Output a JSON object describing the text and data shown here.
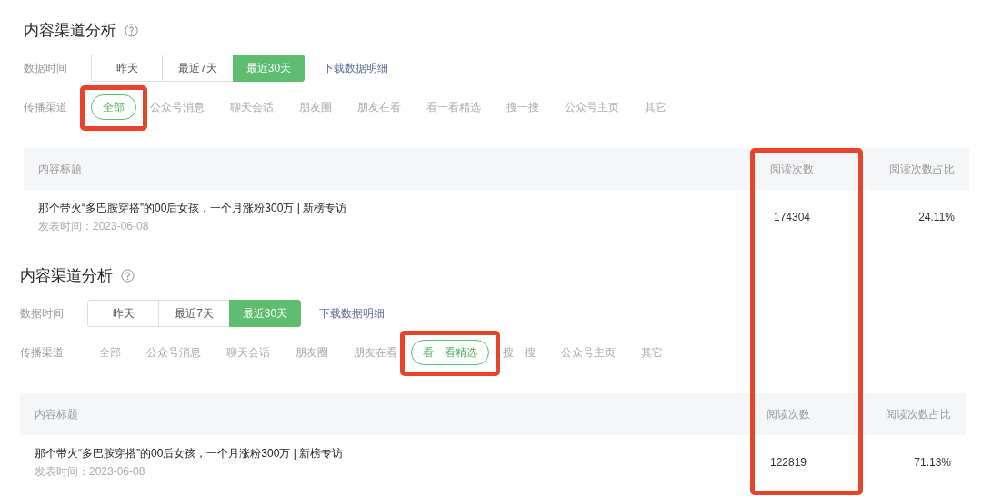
{
  "panels": [
    {
      "title": "内容渠道分析",
      "time_label": "数据时间",
      "time_options": [
        {
          "label": "昨天",
          "selected": false
        },
        {
          "label": "最近7天",
          "selected": false
        },
        {
          "label": "最近30天",
          "selected": true
        }
      ],
      "download_link": "下载数据明细",
      "channel_label": "传播渠道",
      "channels": [
        {
          "label": "全部",
          "selected": true,
          "highlighted": true
        },
        {
          "label": "公众号消息",
          "selected": false,
          "highlighted": false
        },
        {
          "label": "聊天会话",
          "selected": false,
          "highlighted": false
        },
        {
          "label": "朋友圈",
          "selected": false,
          "highlighted": false
        },
        {
          "label": "朋友在看",
          "selected": false,
          "highlighted": false
        },
        {
          "label": "看一看精选",
          "selected": false,
          "highlighted": false
        },
        {
          "label": "搜一搜",
          "selected": false,
          "highlighted": false
        },
        {
          "label": "公众号主页",
          "selected": false,
          "highlighted": false
        },
        {
          "label": "其它",
          "selected": false,
          "highlighted": false
        }
      ],
      "table": {
        "columns": [
          "内容标题",
          "阅读次数",
          "阅读次数占比"
        ],
        "rows": [
          {
            "title": "那个带火“多巴胺穿搭”的00后女孩，一个月涨粉300万 | 新榜专访",
            "date": "发表时间：2023-06-08",
            "reads": "174304",
            "ratio": "24.11%"
          }
        ]
      }
    },
    {
      "title": "内容渠道分析",
      "time_label": "数据时间",
      "time_options": [
        {
          "label": "昨天",
          "selected": false
        },
        {
          "label": "最近7天",
          "selected": false
        },
        {
          "label": "最近30天",
          "selected": true
        }
      ],
      "download_link": "下载数据明细",
      "channel_label": "传播渠道",
      "channels": [
        {
          "label": "全部",
          "selected": false,
          "highlighted": false
        },
        {
          "label": "公众号消息",
          "selected": false,
          "highlighted": false
        },
        {
          "label": "聊天会话",
          "selected": false,
          "highlighted": false
        },
        {
          "label": "朋友圈",
          "selected": false,
          "highlighted": false
        },
        {
          "label": "朋友在看",
          "selected": false,
          "highlighted": false
        },
        {
          "label": "看一看精选",
          "selected": true,
          "highlighted": true
        },
        {
          "label": "搜一搜",
          "selected": false,
          "highlighted": false
        },
        {
          "label": "公众号主页",
          "selected": false,
          "highlighted": false
        },
        {
          "label": "其它",
          "selected": false,
          "highlighted": false
        }
      ],
      "table": {
        "columns": [
          "内容标题",
          "阅读次数",
          "阅读次数占比"
        ],
        "rows": [
          {
            "title": "那个带火“多巴胺穿搭”的00后女孩，一个月涨粉300万 | 新榜专访",
            "date": "发表时间：2023-06-08",
            "reads": "122819",
            "ratio": "71.13%"
          }
        ]
      }
    }
  ],
  "reads_column_highlighted": true
}
